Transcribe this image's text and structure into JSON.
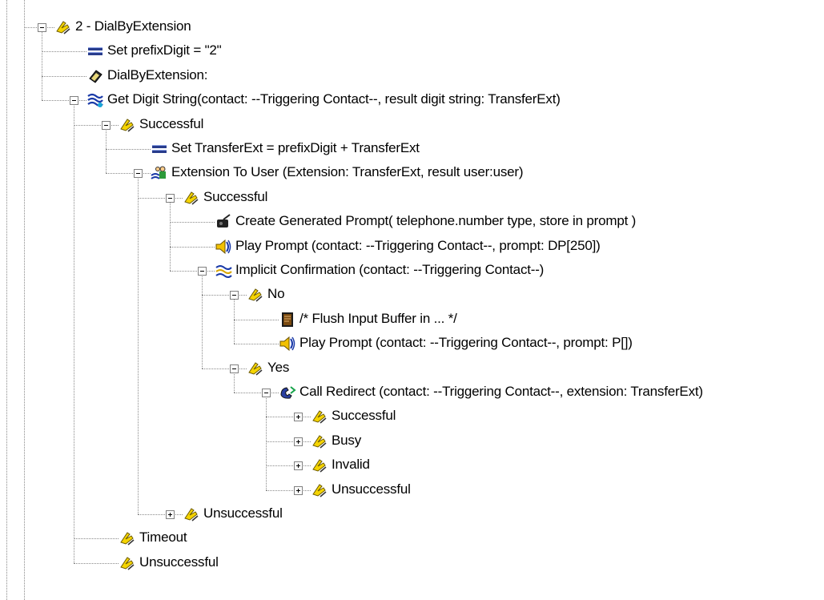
{
  "tree": {
    "nodes": [
      {
        "id": "n0",
        "depth": 0,
        "icon": "label-tag-icon",
        "label": "2 - DialByExtension",
        "expander": "minus"
      },
      {
        "id": "n1",
        "depth": 1,
        "icon": "set-variable-icon",
        "label": "Set prefixDigit = \"2\"",
        "expander": null
      },
      {
        "id": "n2",
        "depth": 1,
        "icon": "goto-label-icon",
        "label": "DialByExtension:",
        "expander": null
      },
      {
        "id": "n3",
        "depth": 1,
        "icon": "get-digit-icon",
        "label": "Get Digit String(contact: --Triggering Contact--, result digit string: TransferExt)",
        "expander": "minus"
      },
      {
        "id": "n4",
        "depth": 2,
        "icon": "label-tag-icon",
        "label": "Successful",
        "expander": "minus"
      },
      {
        "id": "n5",
        "depth": 3,
        "icon": "set-variable-icon",
        "label": "Set TransferExt = prefixDigit + TransferExt",
        "expander": null
      },
      {
        "id": "n6",
        "depth": 3,
        "icon": "extension-user-icon",
        "label": "Extension To User (Extension: TransferExt, result user:user)",
        "expander": "minus"
      },
      {
        "id": "n7",
        "depth": 4,
        "icon": "label-tag-icon",
        "label": "Successful",
        "expander": "minus"
      },
      {
        "id": "n8",
        "depth": 5,
        "icon": "generated-prompt-icon",
        "label": "Create Generated Prompt( telephone.number type, store in prompt )",
        "expander": null
      },
      {
        "id": "n9",
        "depth": 5,
        "icon": "play-prompt-icon",
        "label": "Play Prompt (contact: --Triggering Contact--, prompt: DP[250])",
        "expander": null
      },
      {
        "id": "n10",
        "depth": 5,
        "icon": "confirmation-icon",
        "label": "Implicit Confirmation (contact: --Triggering Contact--)",
        "expander": "minus"
      },
      {
        "id": "n11",
        "depth": 6,
        "icon": "label-tag-icon",
        "label": "No",
        "expander": "minus"
      },
      {
        "id": "n12",
        "depth": 7,
        "icon": "comment-icon",
        "label": "/* Flush Input Buffer in ... */",
        "expander": null
      },
      {
        "id": "n13",
        "depth": 7,
        "icon": "play-prompt-icon",
        "label": "Play Prompt (contact: --Triggering Contact--, prompt: P[])",
        "expander": null
      },
      {
        "id": "n14",
        "depth": 6,
        "icon": "label-tag-icon",
        "label": "Yes",
        "expander": "minus"
      },
      {
        "id": "n15",
        "depth": 7,
        "icon": "call-redirect-icon",
        "label": "Call Redirect (contact: --Triggering Contact--, extension: TransferExt)",
        "expander": "minus"
      },
      {
        "id": "n16",
        "depth": 8,
        "icon": "label-tag-icon",
        "label": "Successful",
        "expander": "plus"
      },
      {
        "id": "n17",
        "depth": 8,
        "icon": "label-tag-icon",
        "label": "Busy",
        "expander": "plus"
      },
      {
        "id": "n18",
        "depth": 8,
        "icon": "label-tag-icon",
        "label": "Invalid",
        "expander": "plus"
      },
      {
        "id": "n19",
        "depth": 8,
        "icon": "label-tag-icon",
        "label": "Unsuccessful",
        "expander": "plus"
      },
      {
        "id": "n20",
        "depth": 4,
        "icon": "label-tag-icon",
        "label": "Unsuccessful",
        "expander": "plus"
      },
      {
        "id": "n21",
        "depth": 2,
        "icon": "label-tag-icon",
        "label": "Timeout",
        "expander": null
      },
      {
        "id": "n22",
        "depth": 2,
        "icon": "label-tag-icon",
        "label": "Unsuccessful",
        "expander": null
      }
    ]
  }
}
